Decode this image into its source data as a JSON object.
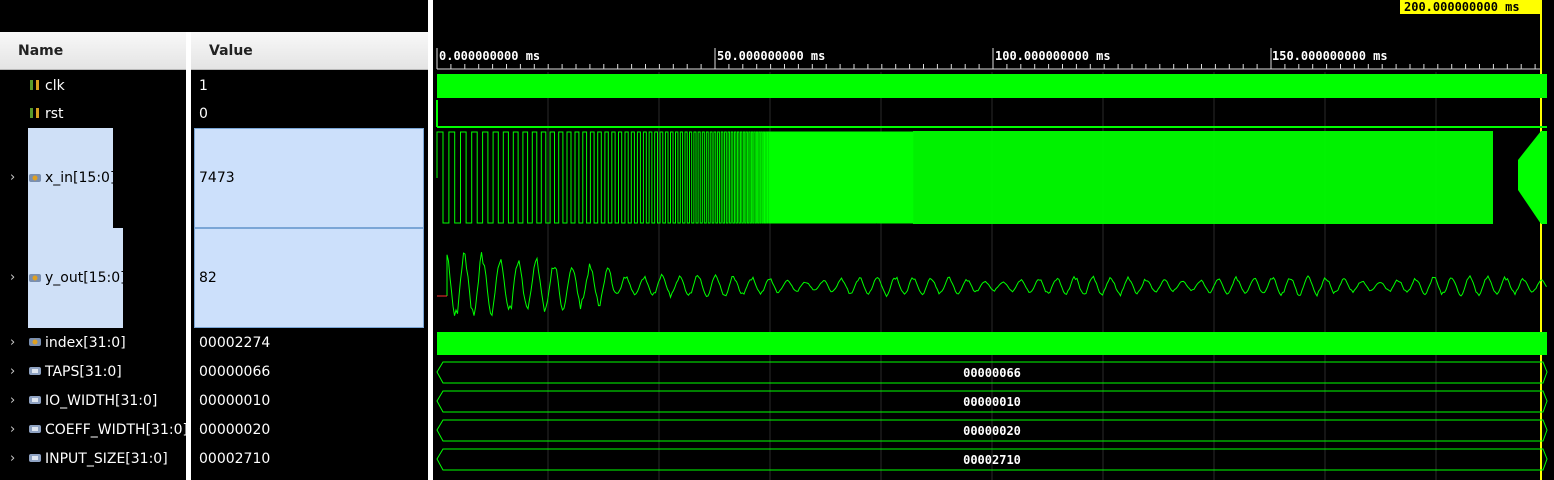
{
  "columns": {
    "name": "Name",
    "value": "Value"
  },
  "cursor_label": "200.000000000 ms",
  "timeline": {
    "ticks": [
      "0.000000000 ms",
      "50.000000000 ms",
      "100.000000000 ms",
      "150.000000000 ms"
    ]
  },
  "signals": [
    {
      "name": "clk",
      "value": "1",
      "icon": "logic-signal-icon"
    },
    {
      "name": "rst",
      "value": "0",
      "icon": "logic-signal-icon"
    },
    {
      "name": "x_in[15:0]",
      "value": "7473",
      "icon": "bus-signal-icon"
    },
    {
      "name": "y_out[15:0]",
      "value": "82",
      "icon": "bus-signal-icon"
    },
    {
      "name": "index[31:0]",
      "value": "00002274",
      "icon": "bus-signal-icon"
    },
    {
      "name": "TAPS[31:0]",
      "value": "00000066",
      "icon": "parameter-bus-icon"
    },
    {
      "name": "IO_WIDTH[31:0]",
      "value": "00000010",
      "icon": "parameter-bus-icon"
    },
    {
      "name": "COEFF_WIDTH[31:0]",
      "value": "00000020",
      "icon": "parameter-bus-icon"
    },
    {
      "name": "INPUT_SIZE[31:0]",
      "value": "00002710",
      "icon": "parameter-bus-icon"
    }
  ],
  "bus_labels": [
    "00000066",
    "00000010",
    "00000020",
    "00002710"
  ],
  "colors": {
    "wave": "#00ff00",
    "cursor": "#ffff00",
    "selection": "#cce0fb"
  }
}
